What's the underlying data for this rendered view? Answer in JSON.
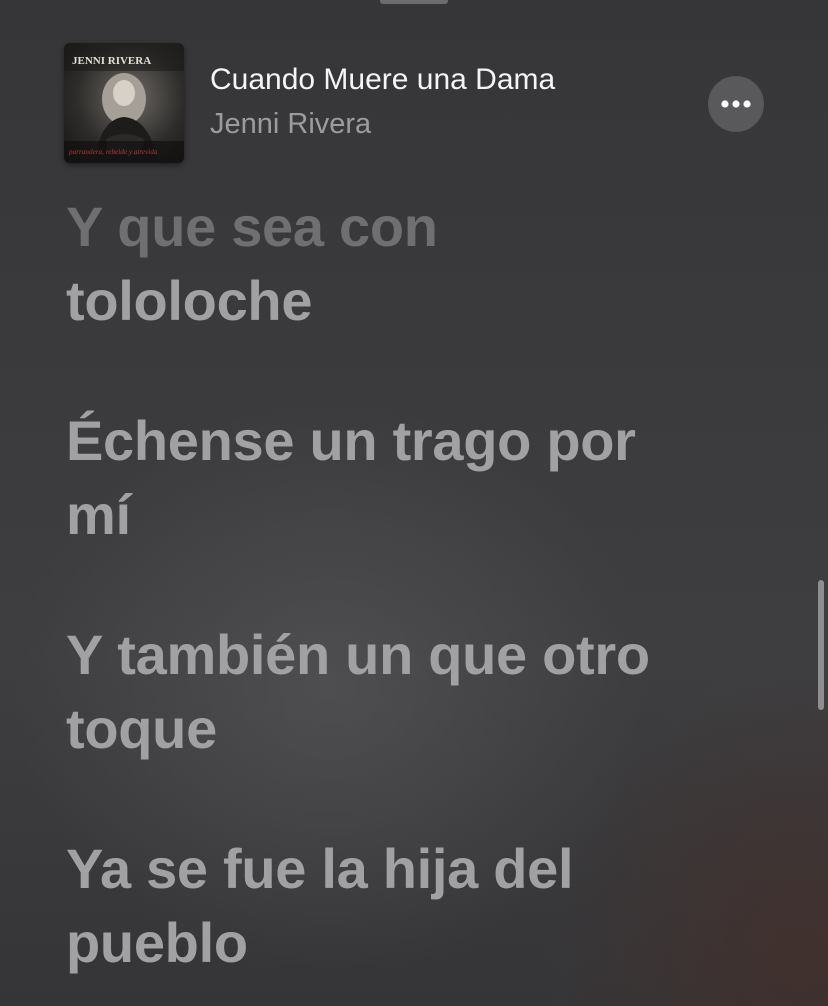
{
  "now_playing": {
    "title": "Cuando Muere una Dama",
    "artist": "Jenni Rivera",
    "artwork": {
      "brand_text": "JENNI RIVERA",
      "subtitle_text": "parrandera, rebelde y atrevida"
    }
  },
  "menu_button": {
    "icon": "more-ellipsis-icon"
  },
  "lyrics": [
    {
      "line1": "Y que sea con",
      "line2": "tololoche"
    },
    {
      "line1": "Échense un trago por",
      "line2": "mí"
    },
    {
      "line1": "Y también un que otro",
      "line2": "toque"
    },
    {
      "line1": "Ya se fue la hija del",
      "line2": "pueblo"
    }
  ],
  "colors": {
    "background": "#3b3b3d",
    "title": "#f5f5f5",
    "artist": "#9c9c9e",
    "lyric": "#a1a1a3",
    "lyric_faded": "#6f6f71"
  }
}
